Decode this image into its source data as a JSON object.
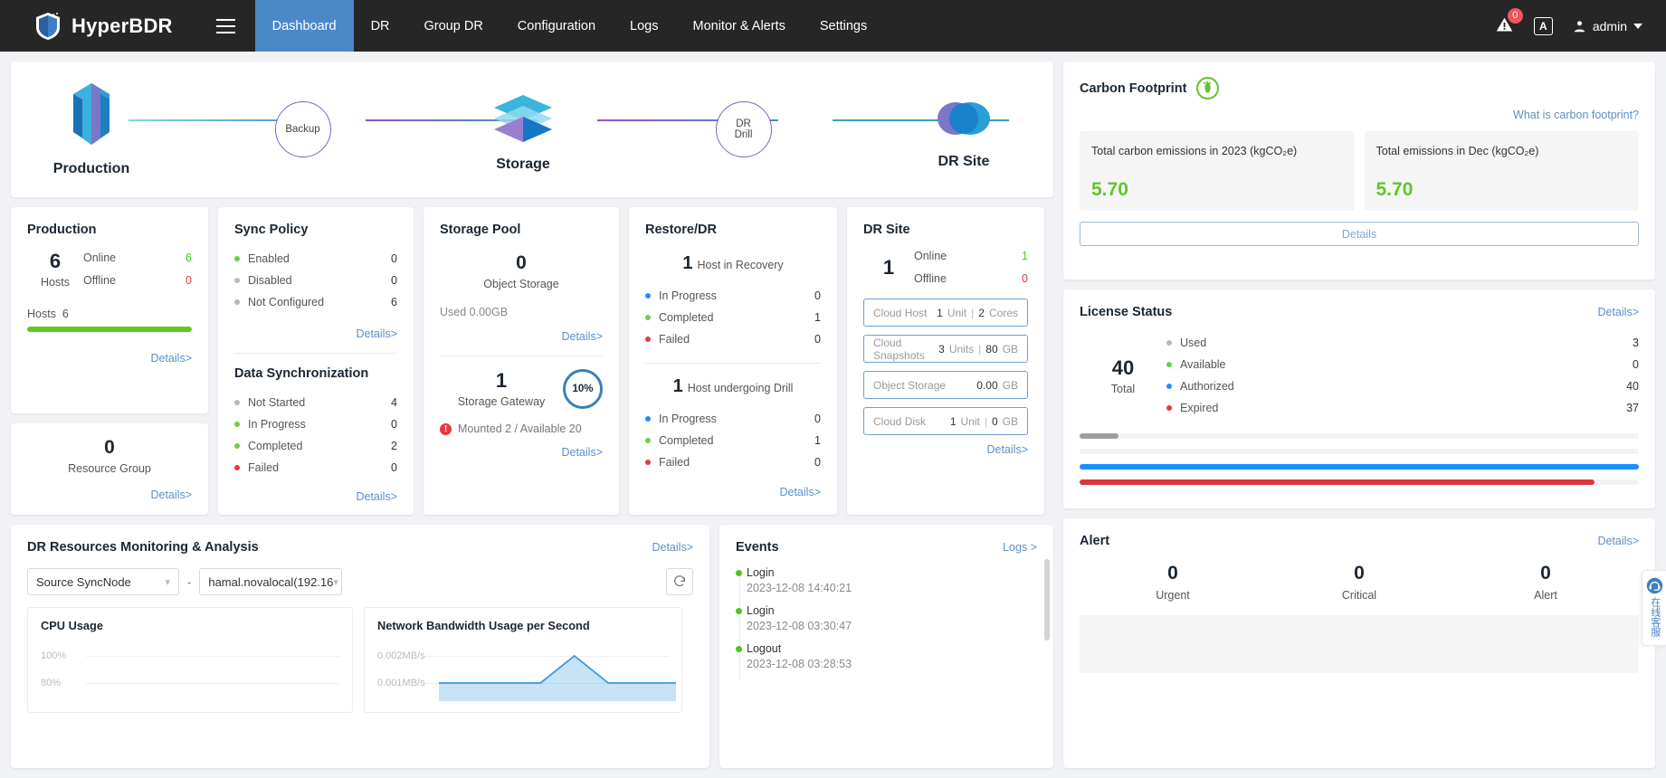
{
  "navbar": {
    "brand": "HyperBDR",
    "menu_icon": "hamburger-icon",
    "links": [
      "Dashboard",
      "DR",
      "Group DR",
      "Configuration",
      "Logs",
      "Monitor & Alerts",
      "Settings"
    ],
    "active_link": "Dashboard",
    "alarm_badge": "0",
    "language_label": "A",
    "user": "admin"
  },
  "flow": {
    "production_label": "Production",
    "backup_label": "Backup",
    "storage_label": "Storage",
    "drill_label_1": "DR",
    "drill_label_2": "Drill",
    "drsite_label": "DR Site"
  },
  "production": {
    "title": "Production",
    "count": "6",
    "count_unit": "Hosts",
    "rows": [
      {
        "label": "Online",
        "value": "6",
        "color": "green"
      },
      {
        "label": "Offline",
        "value": "0",
        "color": "red"
      }
    ],
    "bar_label": "Hosts",
    "bar_value": "6",
    "bar_percent": 100,
    "bar_color": "#64c81e",
    "details": "Details>"
  },
  "resource_group": {
    "count": "0",
    "label": "Resource Group",
    "details": "Details>"
  },
  "sync_policy": {
    "title": "Sync Policy",
    "rows": [
      {
        "label": "Enabled",
        "value": "0",
        "dot": "green"
      },
      {
        "label": "Disabled",
        "value": "0",
        "dot": "grey"
      },
      {
        "label": "Not Configured",
        "value": "6",
        "dot": "grey"
      }
    ],
    "details": "Details>"
  },
  "data_sync": {
    "title": "Data Synchronization",
    "rows": [
      {
        "label": "Not Started",
        "value": "4",
        "dot": "grey"
      },
      {
        "label": "In Progress",
        "value": "0",
        "dot": "green"
      },
      {
        "label": "Completed",
        "value": "2",
        "dot": "green"
      },
      {
        "label": "Failed",
        "value": "0",
        "dot": "red"
      }
    ],
    "details": "Details>"
  },
  "storage_pool": {
    "title": "Storage Pool",
    "object_storage_count": "0",
    "object_storage_label": "Object Storage",
    "used_text": "Used 0.00GB",
    "details": "Details>",
    "gateway_count": "1",
    "gateway_label": "Storage Gateway",
    "gauge_percent": "10%",
    "gauge_value": 10,
    "mounted_text": "Mounted 2 / Available 20",
    "gateway_details": "Details>"
  },
  "restore_dr": {
    "title": "Restore/DR",
    "recovery_count": "1",
    "recovery_label": "Host in Recovery",
    "recovery_rows": [
      {
        "label": "In Progress",
        "value": "0",
        "dot": "blue"
      },
      {
        "label": "Completed",
        "value": "1",
        "dot": "green"
      },
      {
        "label": "Failed",
        "value": "0",
        "dot": "red"
      }
    ],
    "drill_count": "1",
    "drill_label": "Host undergoing Drill",
    "drill_rows": [
      {
        "label": "In Progress",
        "value": "0",
        "dot": "blue"
      },
      {
        "label": "Completed",
        "value": "1",
        "dot": "green"
      },
      {
        "label": "Failed",
        "value": "0",
        "dot": "red"
      }
    ],
    "details": "Details>"
  },
  "dr_site": {
    "title": "DR Site",
    "count": "1",
    "rows": [
      {
        "label": "Online",
        "value": "1",
        "color": "green"
      },
      {
        "label": "Offline",
        "value": "0",
        "color": "red"
      }
    ],
    "units": [
      {
        "name": "Cloud Host",
        "v1": "1",
        "u1": "Unit",
        "v2": "2",
        "u2": "Cores"
      },
      {
        "name": "Cloud Snapshots",
        "v1": "3",
        "u1": "Units",
        "v2": "80",
        "u2": "GB"
      },
      {
        "name": "Object Storage",
        "v1": "",
        "u1": "",
        "v2": "0.00",
        "u2": "GB"
      },
      {
        "name": "Cloud Disk",
        "v1": "1",
        "u1": "Unit",
        "v2": "0",
        "u2": "GB"
      }
    ],
    "details": "Details>"
  },
  "carbon": {
    "title": "Carbon Footprint",
    "icon": "footprint-icon",
    "help_link": "What is carbon footprint?",
    "boxes": [
      {
        "label": "Total carbon emissions in 2023 (kgCO₂e)",
        "value": "5.70"
      },
      {
        "label": "Total emissions in Dec (kgCO₂e)",
        "value": "5.70"
      }
    ],
    "details": "Details"
  },
  "license": {
    "title": "License Status",
    "details": "Details>",
    "total": "40",
    "total_label": "Total",
    "rows": [
      {
        "label": "Used",
        "value": "3",
        "dot": "grey",
        "percent": 7,
        "color": "#9e9e9e"
      },
      {
        "label": "Available",
        "value": "0",
        "dot": "green",
        "percent": 0,
        "color": "#6fcf3f"
      },
      {
        "label": "Authorized",
        "value": "40",
        "dot": "blue",
        "percent": 100,
        "color": "#1890ff"
      },
      {
        "label": "Expired",
        "value": "37",
        "dot": "red",
        "percent": 92,
        "color": "#d9363e"
      }
    ]
  },
  "monitor": {
    "title": "DR Resources Monitoring & Analysis",
    "details": "Details>",
    "select1": "Source SyncNode",
    "separator": "-",
    "select2": "hamal.novalocal(192.16",
    "refresh_icon": "refresh-icon",
    "charts": [
      {
        "title": "CPU Usage",
        "yticks": [
          "100%",
          "80%"
        ]
      },
      {
        "title": "Network Bandwidth Usage per Second",
        "yticks": [
          "0.002MB/s",
          "0.001MB/s"
        ]
      }
    ]
  },
  "chart_data": [
    {
      "type": "line",
      "title": "CPU Usage",
      "ylabel": "",
      "xlabel": "",
      "ytick_labels": [
        "100%",
        "80%"
      ],
      "ytick_values": [
        100,
        80
      ],
      "x": [],
      "values": [],
      "grid": true
    },
    {
      "type": "area",
      "title": "Network Bandwidth Usage per Second",
      "ylabel": "",
      "xlabel": "",
      "ytick_labels": [
        "0.002MB/s",
        "0.001MB/s"
      ],
      "ytick_values": [
        0.002,
        0.001
      ],
      "x": [
        0,
        1,
        2,
        3,
        4,
        5,
        6,
        7
      ],
      "values": [
        0.001,
        0.001,
        0.001,
        0.001,
        0.002,
        0.001,
        0.001,
        0.001
      ],
      "line_color": "#3a9ae0",
      "grid": true
    }
  ],
  "events": {
    "title": "Events",
    "logs_link": "Logs >",
    "items": [
      {
        "name": "Login",
        "time": "2023-12-08 14:40:21"
      },
      {
        "name": "Login",
        "time": "2023-12-08 03:30:47"
      },
      {
        "name": "Logout",
        "time": "2023-12-08 03:28:53"
      }
    ]
  },
  "alert": {
    "title": "Alert",
    "details": "Details>",
    "cells": [
      {
        "value": "0",
        "label": "Urgent"
      },
      {
        "value": "0",
        "label": "Critical"
      },
      {
        "value": "0",
        "label": "Alert"
      }
    ]
  },
  "chat": {
    "icon": "headset-icon",
    "text": "在线客服"
  }
}
